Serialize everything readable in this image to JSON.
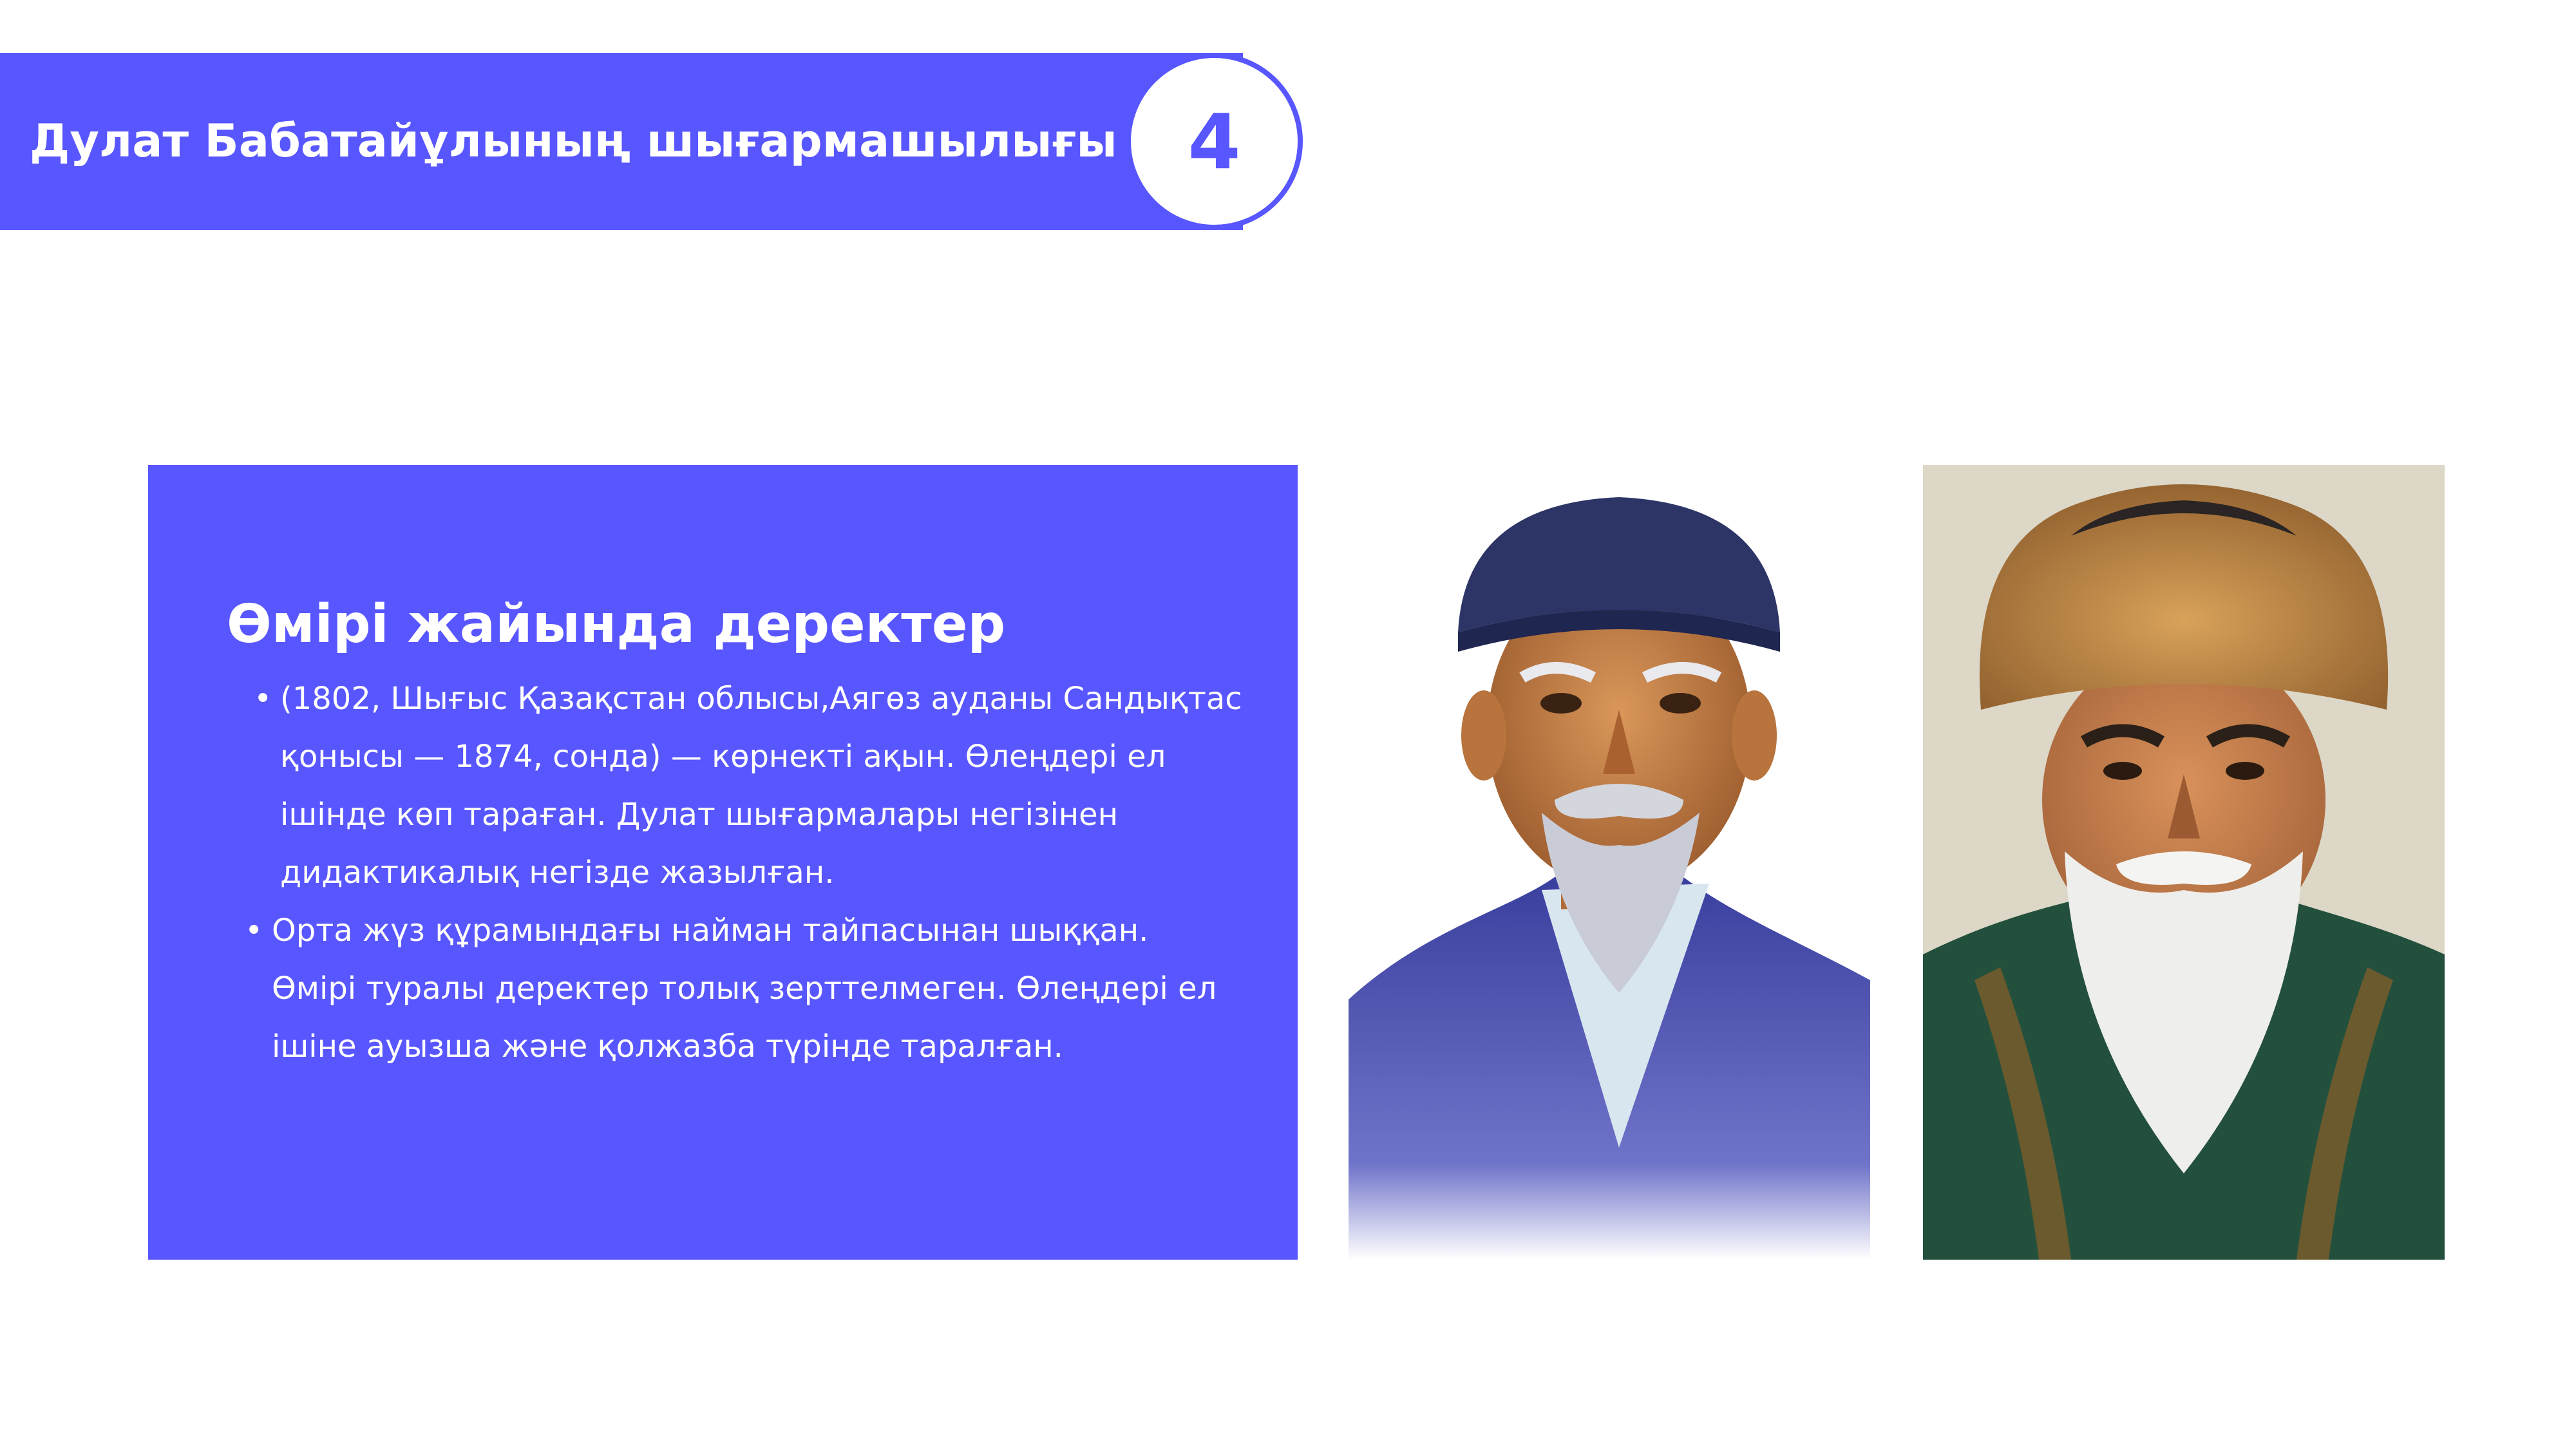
{
  "header": {
    "title": "Дулат Бабатайұлының шығармашылығы",
    "slide_number": "4"
  },
  "info": {
    "heading": "Өмірі жайында деректер",
    "bullet_symbol": "•",
    "items": [
      {
        "lines": [
          "(1802, Шығыс Қазақстан облысы,Аягөз ауданы Сандықтас",
          "қонысы — 1874, сонда) — көрнекті ақын. Өлеңдері ел",
          "ішінде көп тараған. Дулат шығармалары негізінен",
          "дидактикалық негізде жазылған."
        ]
      },
      {
        "lines": [
          "Орта жүз құрамындағы найман тайпасынан шыққан.",
          "Өмірі туралы деректер толық зерттелмеген. Өлеңдері ел",
          "ішіне ауызша және қолжазба түрінде таралған."
        ]
      }
    ]
  },
  "colors": {
    "accent": "#5856FE",
    "text_on_accent": "#FFFFFF",
    "background": "#FFFFFF"
  }
}
